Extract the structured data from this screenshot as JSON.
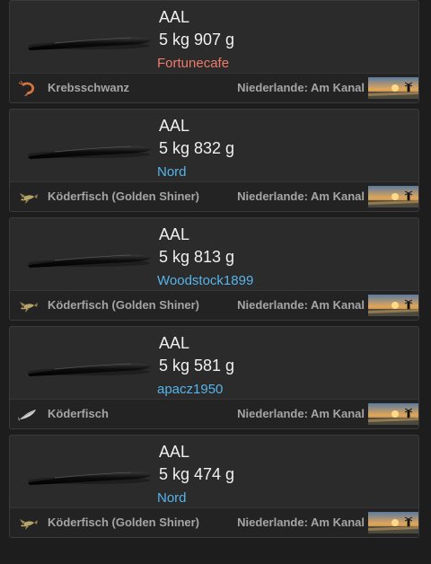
{
  "catches": [
    {
      "species": "AAL",
      "weight": "5 kg 907 g",
      "player": "Fortunecafe",
      "player_color": "#f07a6a",
      "bait": "Krebsschwanz",
      "bait_icon": "shrimp-icon",
      "location": "Niederlande: Am Kanal"
    },
    {
      "species": "AAL",
      "weight": "5 kg 832 g",
      "player": "Nord",
      "player_color": "#56b4ea",
      "bait": "Köderfisch (Golden Shiner)",
      "bait_icon": "small-fish-icon",
      "location": "Niederlande: Am Kanal"
    },
    {
      "species": "AAL",
      "weight": "5 kg 813 g",
      "player": "Woodstock1899",
      "player_color": "#56b4ea",
      "bait": "Köderfisch (Golden Shiner)",
      "bait_icon": "small-fish-icon",
      "location": "Niederlande: Am Kanal"
    },
    {
      "species": "AAL",
      "weight": "5 kg 581 g",
      "player": "apacz1950",
      "player_color": "#56b4ea",
      "bait": "Köderfisch",
      "bait_icon": "silver-fish-icon",
      "location": "Niederlande: Am Kanal"
    },
    {
      "species": "AAL",
      "weight": "5 kg 474 g",
      "player": "Nord",
      "player_color": "#56b4ea",
      "bait": "Köderfisch (Golden Shiner)",
      "bait_icon": "small-fish-icon",
      "location": "Niederlande: Am Kanal"
    }
  ]
}
